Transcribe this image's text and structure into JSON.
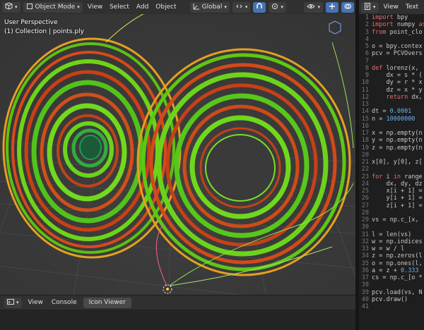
{
  "header": {
    "mode": "Object Mode",
    "menus": [
      "View",
      "Select",
      "Add",
      "Object"
    ],
    "orientation": "Global"
  },
  "viewport": {
    "perspective": "User Perspective",
    "collection": "(1) Collection | points.ply"
  },
  "bottom": {
    "menus": [
      "View",
      "Console"
    ],
    "active_tab": "Icon Viewer"
  },
  "editor": {
    "menus": [
      "View",
      "Text"
    ],
    "lines": [
      {
        "n": "1",
        "parts": [
          {
            "t": "import",
            "c": "kw"
          },
          {
            "t": " bpy",
            "c": "tx"
          }
        ]
      },
      {
        "n": "2",
        "parts": [
          {
            "t": "import",
            "c": "kw"
          },
          {
            "t": " numpy ",
            "c": "tx"
          },
          {
            "t": "as",
            "c": "kw"
          }
        ]
      },
      {
        "n": "3",
        "parts": [
          {
            "t": "from",
            "c": "kw"
          },
          {
            "t": " point_clo",
            "c": "tx"
          }
        ]
      },
      {
        "n": "4",
        "parts": []
      },
      {
        "n": "5",
        "parts": [
          {
            "t": "o = bpy.contex",
            "c": "tx"
          }
        ]
      },
      {
        "n": "6",
        "parts": [
          {
            "t": "pcv = PCVOvers",
            "c": "tx"
          }
        ]
      },
      {
        "n": "7",
        "parts": []
      },
      {
        "n": "8",
        "parts": [
          {
            "t": "def",
            "c": "kw"
          },
          {
            "t": " lorenz(x, ",
            "c": "tx"
          }
        ]
      },
      {
        "n": "9",
        "parts": [
          {
            "t": "    dx = s * (",
            "c": "tx"
          }
        ]
      },
      {
        "n": "10",
        "parts": [
          {
            "t": "    dy = r * x",
            "c": "tx"
          }
        ]
      },
      {
        "n": "11",
        "parts": [
          {
            "t": "    dz = x * y",
            "c": "tx"
          }
        ]
      },
      {
        "n": "12",
        "parts": [
          {
            "t": "    ",
            "c": "tx"
          },
          {
            "t": "return",
            "c": "kw"
          },
          {
            "t": " dx,",
            "c": "tx"
          }
        ]
      },
      {
        "n": "13",
        "parts": []
      },
      {
        "n": "14",
        "parts": [
          {
            "t": "dt = ",
            "c": "tx"
          },
          {
            "t": "0.0001",
            "c": "num"
          }
        ]
      },
      {
        "n": "15",
        "parts": [
          {
            "t": "n = ",
            "c": "tx"
          },
          {
            "t": "10000000",
            "c": "num"
          }
        ]
      },
      {
        "n": "16",
        "parts": []
      },
      {
        "n": "17",
        "parts": [
          {
            "t": "x = np.empty(n",
            "c": "tx"
          }
        ]
      },
      {
        "n": "18",
        "parts": [
          {
            "t": "y = np.empty(n",
            "c": "tx"
          }
        ]
      },
      {
        "n": "19",
        "parts": [
          {
            "t": "z = np.empty(n",
            "c": "tx"
          }
        ]
      },
      {
        "n": "20",
        "parts": []
      },
      {
        "n": "21",
        "parts": [
          {
            "t": "x[0], y[0], z[",
            "c": "tx"
          }
        ]
      },
      {
        "n": "22",
        "parts": []
      },
      {
        "n": "23",
        "parts": [
          {
            "t": "for",
            "c": "kw"
          },
          {
            "t": " i ",
            "c": "tx"
          },
          {
            "t": "in",
            "c": "kw"
          },
          {
            "t": " range",
            "c": "tx"
          }
        ]
      },
      {
        "n": "24",
        "parts": [
          {
            "t": "    dx, dy, dz",
            "c": "tx"
          }
        ]
      },
      {
        "n": "25",
        "parts": [
          {
            "t": "    x[i + 1] =",
            "c": "tx"
          }
        ]
      },
      {
        "n": "26",
        "parts": [
          {
            "t": "    y[i + 1] =",
            "c": "tx"
          }
        ]
      },
      {
        "n": "27",
        "parts": [
          {
            "t": "    z[i + 1] =",
            "c": "tx"
          }
        ]
      },
      {
        "n": "28",
        "parts": []
      },
      {
        "n": "29",
        "parts": [
          {
            "t": "vs = np.c_[x, ",
            "c": "tx"
          }
        ]
      },
      {
        "n": "30",
        "parts": []
      },
      {
        "n": "31",
        "parts": [
          {
            "t": "l = len(vs)",
            "c": "tx"
          }
        ]
      },
      {
        "n": "32",
        "parts": [
          {
            "t": "w = np.indices",
            "c": "tx"
          }
        ]
      },
      {
        "n": "33",
        "parts": [
          {
            "t": "w = w / l",
            "c": "tx"
          }
        ]
      },
      {
        "n": "34",
        "parts": [
          {
            "t": "z = np.zeros(l",
            "c": "tx"
          }
        ]
      },
      {
        "n": "35",
        "parts": [
          {
            "t": "o = np.ones(l,",
            "c": "tx"
          }
        ]
      },
      {
        "n": "36",
        "parts": [
          {
            "t": "a = z + ",
            "c": "tx"
          },
          {
            "t": "0.333",
            "c": "num"
          }
        ]
      },
      {
        "n": "37",
        "parts": [
          {
            "t": "cs = np.c_[o *",
            "c": "tx"
          }
        ]
      },
      {
        "n": "38",
        "parts": []
      },
      {
        "n": "39",
        "parts": [
          {
            "t": "pcv.load(vs, N",
            "c": "tx"
          }
        ]
      },
      {
        "n": "40",
        "parts": [
          {
            "t": "pcv.draw()",
            "c": "tx"
          }
        ]
      },
      {
        "n": "41",
        "parts": []
      }
    ]
  }
}
